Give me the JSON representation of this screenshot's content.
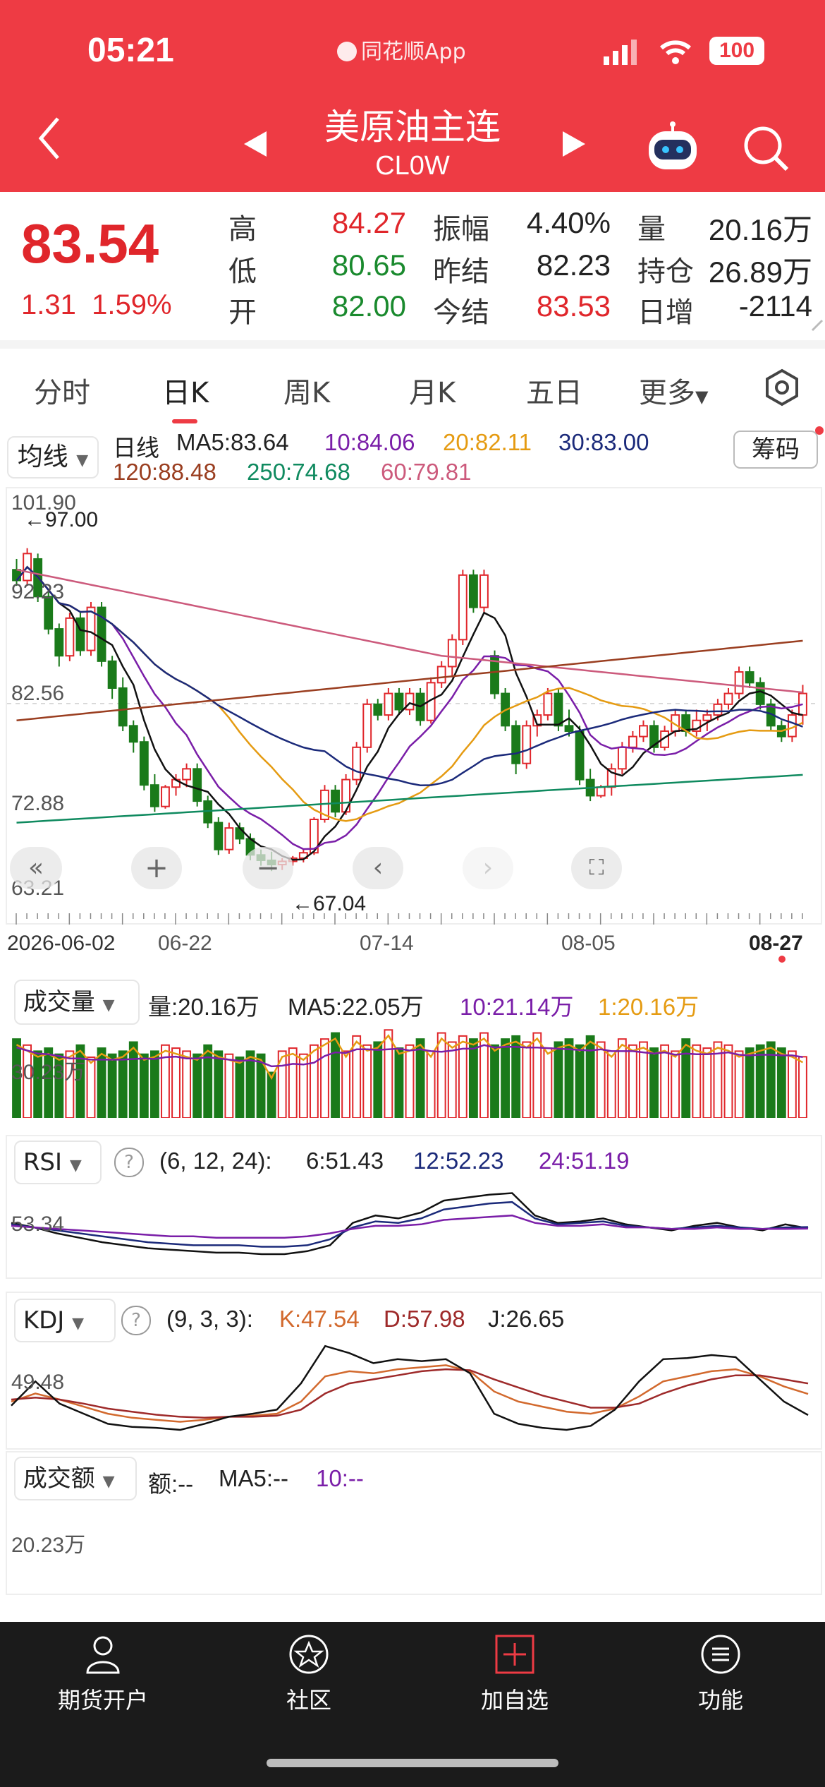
{
  "status_bar": {
    "time": "05:21",
    "app_label": "同花顺App",
    "battery": "100"
  },
  "header": {
    "title": "美原油主连",
    "subtitle": "CL0W"
  },
  "quote": {
    "price": "83.54",
    "change": "1.31",
    "change_pct": "1.59%",
    "high_label": "高",
    "high": "84.27",
    "low_label": "低",
    "low": "80.65",
    "open_label": "开",
    "open": "82.00",
    "amplitude_label": "振幅",
    "amplitude": "4.40%",
    "prev_settle_label": "昨结",
    "prev_settle": "82.23",
    "settle_label": "今结",
    "settle": "83.53",
    "volume_label": "量",
    "volume": "20.16万",
    "open_interest_label": "持仓",
    "open_interest": "26.89万",
    "daily_increase_label": "日增",
    "daily_increase": "-2114"
  },
  "tabs": [
    "分时",
    "日K",
    "周K",
    "月K",
    "五日",
    "更多"
  ],
  "ma_bar": {
    "selector": "均线",
    "line_type": "日线",
    "ma5": "MA5:83.64",
    "ma10": "10:84.06",
    "ma20": "20:82.11",
    "ma30": "30:83.00",
    "ma120": "120:88.48",
    "ma250": "250:74.68",
    "ma60": "60:79.81",
    "chip_button": "筹码"
  },
  "kline": {
    "y_labels": [
      "101.90",
      "92.23",
      "82.56",
      "72.88",
      "63.21"
    ],
    "max_marker": "←97.00",
    "min_marker": "←67.04",
    "x_labels": [
      "2026-06-02",
      "06-22",
      "07-14",
      "08-05",
      "08-27"
    ]
  },
  "volume_panel": {
    "selector": "成交量",
    "vol": "量:20.16万",
    "ma5": "MA5:22.05万",
    "ma10": "10:21.14万",
    "ma1": "1:20.16万",
    "axis_label": "30.23万"
  },
  "rsi_panel": {
    "selector": "RSI",
    "params": "(6, 12, 24):",
    "r6": "6:51.43",
    "r12": "12:52.23",
    "r24": "24:51.19",
    "axis_label": "53.34"
  },
  "kdj_panel": {
    "selector": "KDJ",
    "params": "(9, 3, 3):",
    "k": "K:47.54",
    "d": "D:57.98",
    "j": "J:26.65",
    "axis_label": "49.48"
  },
  "amount_panel": {
    "selector": "成交额",
    "amount": "额:--",
    "ma5": "MA5:--",
    "ma10": "10:--",
    "axis_label": "20.23万"
  },
  "bottom_nav": [
    {
      "label": "期货开户",
      "icon": "person-icon"
    },
    {
      "label": "社区",
      "icon": "star-icon"
    },
    {
      "label": "加自选",
      "icon": "plus-icon"
    },
    {
      "label": "功能",
      "icon": "menu-icon"
    }
  ],
  "chart_data": [
    {
      "type": "candlestick",
      "title": "",
      "xlabel": "",
      "ylabel": "",
      "ylim": [
        63.21,
        101.9
      ],
      "x_ticks": [
        "2026-06-02",
        "06-22",
        "07-14",
        "08-05",
        "08-27"
      ],
      "candles_ohlc": [
        [
          95,
          96,
          93.5,
          94
        ],
        [
          94,
          97,
          93.5,
          96.5
        ],
        [
          96,
          96.5,
          92,
          92.5
        ],
        [
          92.5,
          93,
          89,
          89.5
        ],
        [
          89.5,
          90,
          86,
          87
        ],
        [
          87,
          91,
          86.5,
          90.5
        ],
        [
          90.5,
          91,
          87,
          87.5
        ],
        [
          87.5,
          92,
          87,
          91.5
        ],
        [
          91.5,
          92,
          86,
          86.5
        ],
        [
          86.5,
          87,
          83,
          84
        ],
        [
          84,
          85,
          80,
          80.5
        ],
        [
          80.5,
          81,
          78,
          79
        ],
        [
          79,
          79.5,
          74.5,
          75
        ],
        [
          75,
          76,
          72.5,
          73
        ],
        [
          73,
          75,
          72.8,
          74.8
        ],
        [
          74.8,
          76,
          74,
          75.5
        ],
        [
          75.5,
          77,
          74.8,
          76.5
        ],
        [
          76.5,
          77,
          73,
          73.5
        ],
        [
          73.5,
          74,
          71,
          71.5
        ],
        [
          71.5,
          72,
          68.5,
          69
        ],
        [
          69,
          71.5,
          68.6,
          71
        ],
        [
          71,
          71.5,
          69.5,
          70
        ],
        [
          70,
          70.5,
          68,
          68.5
        ],
        [
          68.5,
          69,
          67.5,
          68
        ],
        [
          68,
          68.8,
          67,
          67.6
        ],
        [
          67.6,
          68.2,
          67.1,
          67.9
        ],
        [
          67.9,
          68.4,
          67.5,
          68.2
        ],
        [
          68.2,
          69,
          67.8,
          68.7
        ],
        [
          68.7,
          72,
          68.5,
          71.8
        ],
        [
          71.8,
          75,
          71.5,
          74.5
        ],
        [
          74.5,
          75,
          72,
          72.5
        ],
        [
          72.5,
          76,
          72.2,
          75.5
        ],
        [
          75.5,
          79,
          75,
          78.5
        ],
        [
          78.5,
          83,
          78,
          82.5
        ],
        [
          82.5,
          83,
          81,
          81.5
        ],
        [
          81.5,
          84,
          81,
          83.5
        ],
        [
          83.5,
          84,
          81.5,
          82
        ],
        [
          82,
          84,
          81.5,
          83.5
        ],
        [
          83.5,
          84,
          80.5,
          81
        ],
        [
          81,
          85,
          80.7,
          84.5
        ],
        [
          84.5,
          86.5,
          84,
          86
        ],
        [
          86,
          89,
          85,
          88.5
        ],
        [
          88.5,
          95,
          88,
          94.5
        ],
        [
          94.5,
          95,
          91,
          91.5
        ],
        [
          91.5,
          95,
          91,
          94.5
        ],
        [
          87,
          87.5,
          83,
          83.5
        ],
        [
          83.5,
          84,
          80,
          80.5
        ],
        [
          80.5,
          81,
          76,
          77
        ],
        [
          77,
          81,
          76.5,
          80.5
        ],
        [
          80.5,
          82,
          79.5,
          81.5
        ],
        [
          81.5,
          84,
          81,
          83.5
        ],
        [
          83.5,
          84,
          80,
          80.5
        ],
        [
          80.5,
          82,
          79.5,
          80
        ],
        [
          80,
          80.5,
          75,
          75.5
        ],
        [
          75.5,
          76.5,
          73.5,
          74
        ],
        [
          74,
          75,
          73.8,
          74.8
        ],
        [
          74.8,
          77,
          74,
          76.5
        ],
        [
          76.5,
          79,
          76,
          78.5
        ],
        [
          78.5,
          80,
          78,
          79.5
        ],
        [
          79.5,
          81,
          79,
          80.5
        ],
        [
          80.5,
          81,
          78,
          78.5
        ],
        [
          78.5,
          80.5,
          78.2,
          80
        ],
        [
          80,
          82,
          79.5,
          81.5
        ],
        [
          81.5,
          82,
          79.5,
          80
        ],
        [
          80,
          82,
          79.5,
          81
        ],
        [
          81,
          82,
          80,
          81.5
        ],
        [
          81.5,
          83,
          81,
          82.5
        ],
        [
          82.5,
          84,
          82,
          83.5
        ],
        [
          83.5,
          86,
          83,
          85.5
        ],
        [
          85.5,
          86,
          84,
          84.5
        ],
        [
          84.5,
          85,
          82,
          82.5
        ],
        [
          82.5,
          83,
          80,
          80.5
        ],
        [
          80.5,
          81,
          79,
          79.5
        ],
        [
          79.5,
          82,
          79,
          81.5
        ],
        [
          81.5,
          84.3,
          80.6,
          83.5
        ]
      ]
    },
    {
      "type": "bar",
      "title": "成交量",
      "ylim": [
        0,
        30.23
      ],
      "values": [
        26,
        24,
        22,
        23,
        21,
        22,
        24,
        20,
        23,
        21,
        22,
        25,
        21,
        22,
        24,
        23,
        22,
        21,
        24,
        22,
        21,
        20,
        22,
        21,
        15,
        22,
        23,
        21,
        24,
        26,
        28,
        22,
        27,
        24,
        25,
        29,
        23,
        24,
        26,
        22,
        28,
        25,
        27,
        26,
        28,
        24,
        26,
        27,
        25,
        28,
        23,
        25,
        26,
        24,
        27,
        25,
        22,
        26,
        24,
        25,
        23,
        24,
        22,
        26,
        24,
        23,
        25,
        24,
        22,
        23,
        24,
        25,
        23,
        22,
        20.16
      ]
    },
    {
      "type": "line",
      "title": "RSI",
      "series": [
        {
          "name": "6",
          "values": [
            55,
            52,
            48,
            45,
            42,
            40,
            38,
            37,
            36,
            35,
            35,
            34,
            34,
            36,
            40,
            55,
            60,
            58,
            62,
            70,
            72,
            74,
            75,
            60,
            55,
            56,
            58,
            54,
            52,
            50,
            53,
            55,
            52,
            50,
            54,
            51.43
          ]
        },
        {
          "name": "12",
          "values": [
            54,
            52,
            50,
            48,
            46,
            44,
            42,
            41,
            40,
            40,
            40,
            39,
            39,
            40,
            44,
            52,
            56,
            55,
            58,
            64,
            66,
            68,
            69,
            58,
            54,
            55,
            56,
            53,
            52,
            51,
            52,
            53,
            52,
            51,
            52,
            52.23
          ]
        },
        {
          "name": "24",
          "values": [
            53,
            52,
            51,
            50,
            49,
            48,
            47,
            46,
            46,
            45,
            45,
            45,
            45,
            46,
            48,
            51,
            53,
            53,
            54,
            57,
            58,
            59,
            60,
            55,
            53,
            53,
            54,
            52,
            52,
            51,
            51,
            52,
            51,
            51,
            51,
            51.19
          ]
        }
      ]
    },
    {
      "type": "line",
      "title": "KDJ",
      "series": [
        {
          "name": "K",
          "values": [
            40,
            48,
            42,
            35,
            28,
            24,
            22,
            20,
            22,
            25,
            26,
            28,
            40,
            65,
            70,
            68,
            72,
            74,
            76,
            70,
            50,
            40,
            35,
            30,
            28,
            33,
            45,
            60,
            65,
            70,
            72,
            65,
            55,
            47.54
          ]
        },
        {
          "name": "D",
          "values": [
            42,
            44,
            42,
            38,
            33,
            30,
            27,
            25,
            24,
            25,
            25,
            26,
            32,
            48,
            58,
            62,
            66,
            70,
            72,
            71,
            62,
            54,
            46,
            40,
            34,
            34,
            38,
            48,
            56,
            62,
            66,
            66,
            62,
            57.98
          ]
        },
        {
          "name": "J",
          "values": [
            36,
            60,
            38,
            28,
            18,
            15,
            14,
            12,
            18,
            25,
            28,
            32,
            58,
            95,
            88,
            78,
            82,
            80,
            82,
            68,
            28,
            18,
            14,
            12,
            16,
            32,
            60,
            82,
            83,
            86,
            84,
            62,
            40,
            26.65
          ]
        }
      ]
    }
  ]
}
